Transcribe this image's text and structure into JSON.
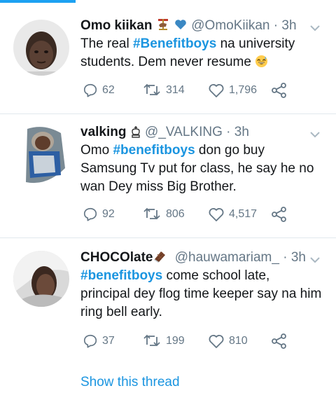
{
  "colors": {
    "accent": "#1da1f2",
    "link": "#1b95e0",
    "muted": "#657786",
    "divider": "#e1e8ed"
  },
  "tweets": [
    {
      "name": "Omo kiikan",
      "handle": "@OmoKiikan",
      "time": "· 3h",
      "badges": [
        "carousel-horse-icon",
        "blue-heart-icon"
      ],
      "text_before": "The real ",
      "hashtag": "#Benefitboys",
      "text_after": " na university students. Dem never resume",
      "emoji": "grinning-sweat-emoji",
      "replies": "62",
      "retweets": "314",
      "likes": "1,796"
    },
    {
      "name": "valking",
      "handle": "@_VALKING",
      "time": "· 3h",
      "badges": [
        "chess-king-icon"
      ],
      "text_before": "Omo ",
      "hashtag": "#benefitboys",
      "text_after": " don go buy Samsung Tv put for class, he say he no wan Dey miss Big Brother.",
      "replies": "92",
      "retweets": "806",
      "likes": "4,517"
    },
    {
      "name": "CHOCOlate",
      "handle": "@hauwamariam_",
      "time": "· 3h",
      "badges": [
        "chocolate-bar-icon"
      ],
      "text_before": "",
      "hashtag": "#benefitboys",
      "text_after": " come school late, principal dey flog time keeper say na him ring bell early.",
      "replies": "37",
      "retweets": "199",
      "likes": "810"
    }
  ],
  "show_thread": "Show this thread"
}
